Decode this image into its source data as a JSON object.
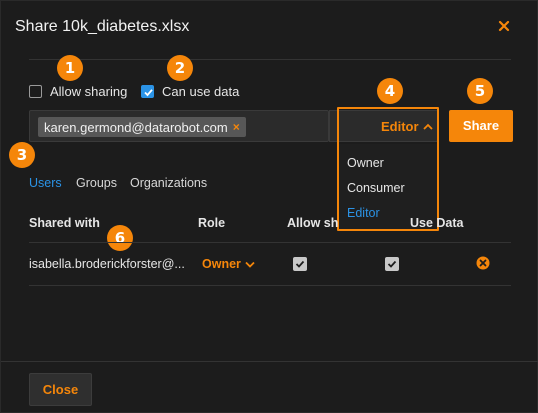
{
  "dialog": {
    "title": "Share 10k_diabetes.xlsx"
  },
  "badges": [
    "1",
    "2",
    "3",
    "4",
    "5",
    "6"
  ],
  "options": {
    "allow_sharing": {
      "label": "Allow sharing",
      "checked": false
    },
    "can_use_data": {
      "label": "Can use data",
      "checked": true
    }
  },
  "recipient": {
    "chip_email": "karen.germond@datarobot.com",
    "chip_remove": "×"
  },
  "role_select": {
    "value": "Editor",
    "options": [
      "Owner",
      "Consumer",
      "Editor"
    ],
    "selected": "Editor"
  },
  "share_button": "Share",
  "tabs": [
    "Users",
    "Groups",
    "Organizations"
  ],
  "active_tab": "Users",
  "table": {
    "headers": [
      "Shared with",
      "Role",
      "Allow sh",
      "Use Data"
    ],
    "rows": [
      {
        "user": "isabella.broderickforster@...",
        "role": "Owner",
        "allow_share": true,
        "use_data": true
      }
    ]
  },
  "close_button": "Close",
  "colors": {
    "accent": "#f5860a",
    "link": "#2b93e6",
    "background": "#1c1c1c"
  }
}
